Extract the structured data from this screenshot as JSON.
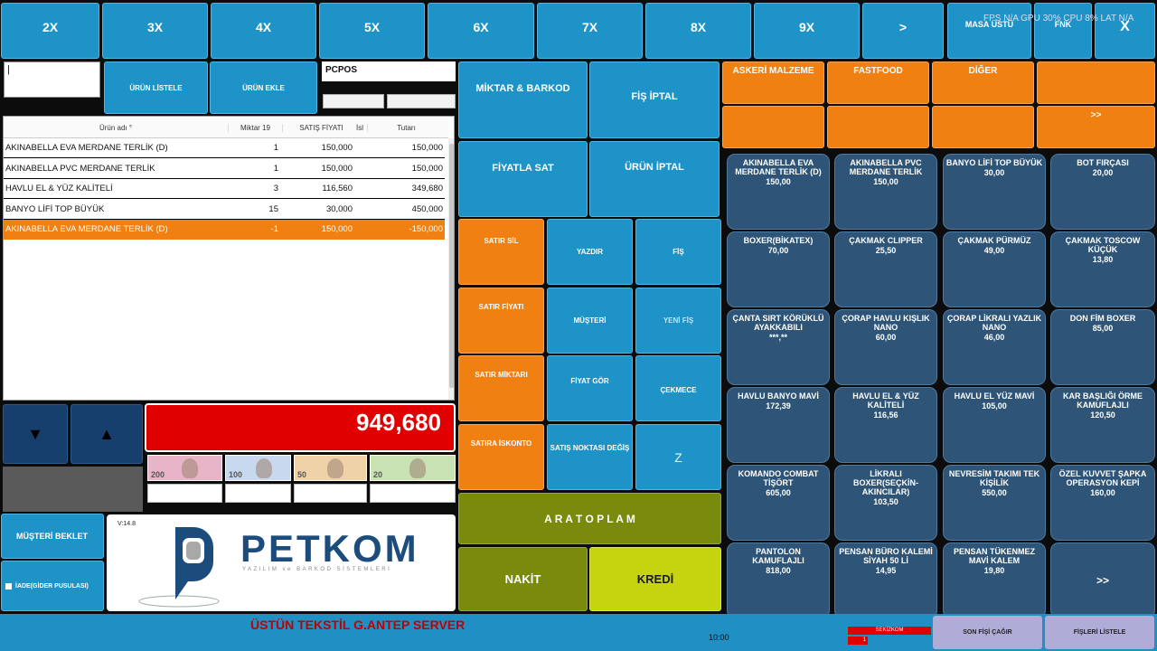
{
  "colors": {
    "accent": "#1e93c8",
    "orange": "#f08012",
    "red_total": "#e00000",
    "olive": "#7a8a0c",
    "lime": "#c5d40e",
    "product": "#2e5577"
  },
  "multipliers": [
    "2X",
    "3X",
    "4X",
    "5X",
    "6X",
    "7X",
    "8X",
    "9X",
    ">"
  ],
  "top_right": {
    "masa_ustu": "MASA ÜSTÜ",
    "fnk": "FNK",
    "close": "X",
    "overlay": "FPS N/A GPU 30% CPU 8% LAT N/A"
  },
  "left": {
    "search_value": "|",
    "urun_listele": "ÜRÜN LİSTELE",
    "urun_ekle": "ÜRÜN EKLE",
    "customer_value": "PCPOS",
    "table_headers": {
      "name": "Ürün adı °",
      "qty": "Miktar 19",
      "price": "SATIŞ FİYATI",
      "disc": "İsl",
      "total": "Tutarı"
    },
    "rows": [
      {
        "name": "AKINABELLA EVA MERDANE TERLİK (D)",
        "qty": "1",
        "price": "150,000",
        "total": "150,000"
      },
      {
        "name": "AKINABELLA PVC MERDANE TERLİK",
        "qty": "1",
        "price": "150,000",
        "total": "150,000"
      },
      {
        "name": "HAVLU EL & YÜZ KALİTELİ",
        "qty": "3",
        "price": "116,560",
        "total": "349,680"
      },
      {
        "name": "BANYO LİFİ TOP BÜYÜK",
        "qty": "15",
        "price": "30,000",
        "total": "450,000"
      },
      {
        "name": "AKINABELLA EVA MERDANE TERLİK (D)",
        "qty": "-1",
        "price": "150,000",
        "total": "-150,000"
      }
    ],
    "total": "949,680",
    "musteri_beklet": "MÜŞTERİ BEKLET",
    "iade": "İADE(GİDER PUSULASI)",
    "version": "V:14.8",
    "logo_name": "PETKOM",
    "logo_tag": "YAZILIM ve BARKOD SİSTEMLERİ",
    "banknotes": [
      "200",
      "100",
      "50",
      "20"
    ]
  },
  "middle": {
    "miktar_barkod": "MİKTAR & BARKOD",
    "fis_iptal": "FİŞ İPTAL",
    "fiyatla_sat": "FİYATLA SAT",
    "urun_iptal": "ÜRÜN İPTAL",
    "satir_sil": "SATIR SİL",
    "satir_fiyati": "SATIR FİYATI",
    "satir_miktari": "SATIR MİKTARI",
    "satira_iskonto": "SATIRA İSKONTO",
    "yazdir": "YAZDIR",
    "musteri": "MÜŞTERİ",
    "fiyat_gor": "FİYAT GÖR",
    "satis_noktasi": "SATIŞ NOKTASI DEĞİŞ",
    "fis": "FİŞ",
    "yeni_fis": "YENİ FİŞ",
    "cekmece": "ÇEKMECE",
    "z": "Z",
    "aratoplam": "A R A T O P L A M",
    "nakit": "NAKİT",
    "kredi": "KREDİ"
  },
  "categories": [
    "ASKERİ MALZEME",
    "FASTFOOD",
    "DİĞER",
    "",
    "",
    "",
    "",
    ">>"
  ],
  "products": [
    {
      "name": "AKINABELLA EVA MERDANE TERLİK (D)",
      "price": "150,00"
    },
    {
      "name": "AKINABELLA PVC MERDANE TERLİK",
      "price": "150,00"
    },
    {
      "name": "BANYO LİFİ TOP BÜYÜK",
      "price": "30,00"
    },
    {
      "name": "BOT FIRÇASI",
      "price": "20,00"
    },
    {
      "name": "BOXER(BİKATEX)",
      "price": "70,00"
    },
    {
      "name": "ÇAKMAK CLIPPER",
      "price": "25,50"
    },
    {
      "name": "ÇAKMAK PÜRMÜZ",
      "price": "49,00"
    },
    {
      "name": "ÇAKMAK TOSCOW KÜÇÜK",
      "price": "13,80"
    },
    {
      "name": "ÇANTA SIRT KÖRÜKLÜ AYAKKABILI",
      "price": "***,**"
    },
    {
      "name": "ÇORAP HAVLU KIŞLIK NANO",
      "price": "60,00"
    },
    {
      "name": "ÇORAP LİKRALI YAZLIK NANO",
      "price": "46,00"
    },
    {
      "name": "DON FİM BOXER",
      "price": "85,00"
    },
    {
      "name": "HAVLU BANYO MAVİ",
      "price": "172,39"
    },
    {
      "name": "HAVLU EL & YÜZ KALİTELİ",
      "price": "116,56"
    },
    {
      "name": "HAVLU EL YÜZ MAVİ",
      "price": "105,00"
    },
    {
      "name": "KAR BAŞLIĞI ÖRME KAMUFLAJLI",
      "price": "120,50"
    },
    {
      "name": "KOMANDO COMBAT TİŞÖRT",
      "price": "605,00"
    },
    {
      "name": "LİKRALI BOXER(SEÇKİN-AKINCILAR)",
      "price": "103,50"
    },
    {
      "name": "NEVRESİM TAKIMI TEK KİŞİLİK",
      "price": "550,00"
    },
    {
      "name": "ÖZEL KUVVET ŞAPKA OPERASYON KEPİ",
      "price": "160,00"
    },
    {
      "name": "PANTOLON KAMUFLAJLI",
      "price": "818,00"
    },
    {
      "name": "PENSAN BÜRO KALEMİ SİYAH 50 Lİ",
      "price": "14,95"
    },
    {
      "name": "PENSAN TÜKENMEZ MAVİ KALEM",
      "price": "19,80"
    },
    {
      "name": ">>",
      "price": ""
    }
  ],
  "status": {
    "company": "ÜSTÜN TEKSTİL G.ANTEP SERVER",
    "time": "10:00",
    "terminal": "SEKİZKOM",
    "terminal_no": "1",
    "son_fisi_cagir": "SON FİŞİ ÇAĞIR",
    "fisleri_listele": "FİŞLERİ LİSTELE"
  }
}
